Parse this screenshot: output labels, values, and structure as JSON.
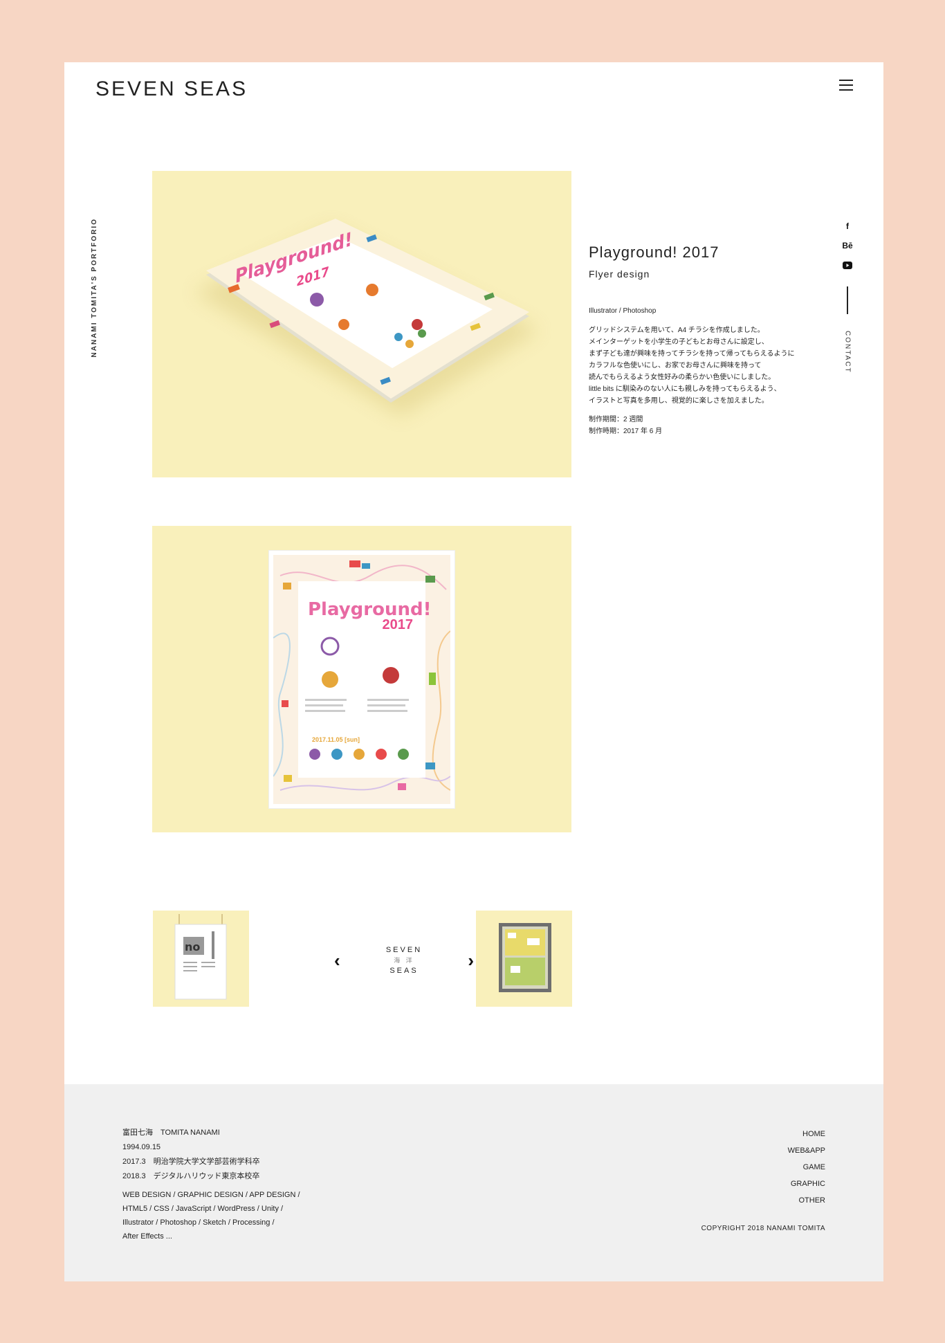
{
  "header": {
    "logo": "SEVEN SEAS"
  },
  "side": {
    "vertical_label": "NANAMI TOMITA'S PORTFORIO",
    "contact": "CONTACT"
  },
  "social": [
    {
      "icon": "facebook-icon",
      "glyph": "f"
    },
    {
      "icon": "behance-icon",
      "glyph": "Bē"
    },
    {
      "icon": "youtube-icon",
      "glyph": "▶"
    }
  ],
  "work": {
    "title": "Playground! 2017",
    "subtitle": "Flyer design",
    "tools": "Illustrator / Photoshop",
    "description": [
      "グリッドシステムを用いて、A4 チラシを作成しました。",
      "メインターゲットを小学生の子どもとお母さんに設定し、",
      "まず子ども達が興味を持ってチラシを持って帰ってもらえるように",
      "カラフルな色使いにし、お家でお母さんに興味を持って",
      "読んでもらえるよう女性好みの柔らかい色使いにしました。",
      "little bits に馴染みのない人にも親しみを持ってもらえるよう、",
      "イラストと写真を多用し、視覚的に楽しさを加えました。"
    ],
    "period": "制作期間：2 週間",
    "date": "制作時期：2017 年 6 月",
    "flyer_title": "Playground!",
    "flyer_year": "2017",
    "flyer_date": "2017.11.05 [sun]"
  },
  "pager": {
    "prev": "‹",
    "next": "›",
    "mini_logo_top": "SEVEN",
    "mini_logo_bottom": "SEAS",
    "mini_logo_mid": "海 洋"
  },
  "footer": {
    "name": "富田七海　TOMITA NANAMI",
    "birth": "1994.09.15",
    "edu1": "2017.3　明治学院大学文学部芸術学科卒",
    "edu2": "2018.3　デジタルハリウッド東京本校卒",
    "skills": [
      "WEB DESIGN / GRAPHIC DESIGN / APP DESIGN /",
      "HTML5 / CSS / JavaScript / WordPress / Unity /",
      "Illustrator / Photoshop / Sketch / Processing /",
      "After Effects ..."
    ],
    "links": [
      "HOME",
      "WEB&APP",
      "GAME",
      "GRAPHIC",
      "OTHER"
    ],
    "copyright": "COPYRIGHT 2018 NANAMI TOMITA"
  }
}
